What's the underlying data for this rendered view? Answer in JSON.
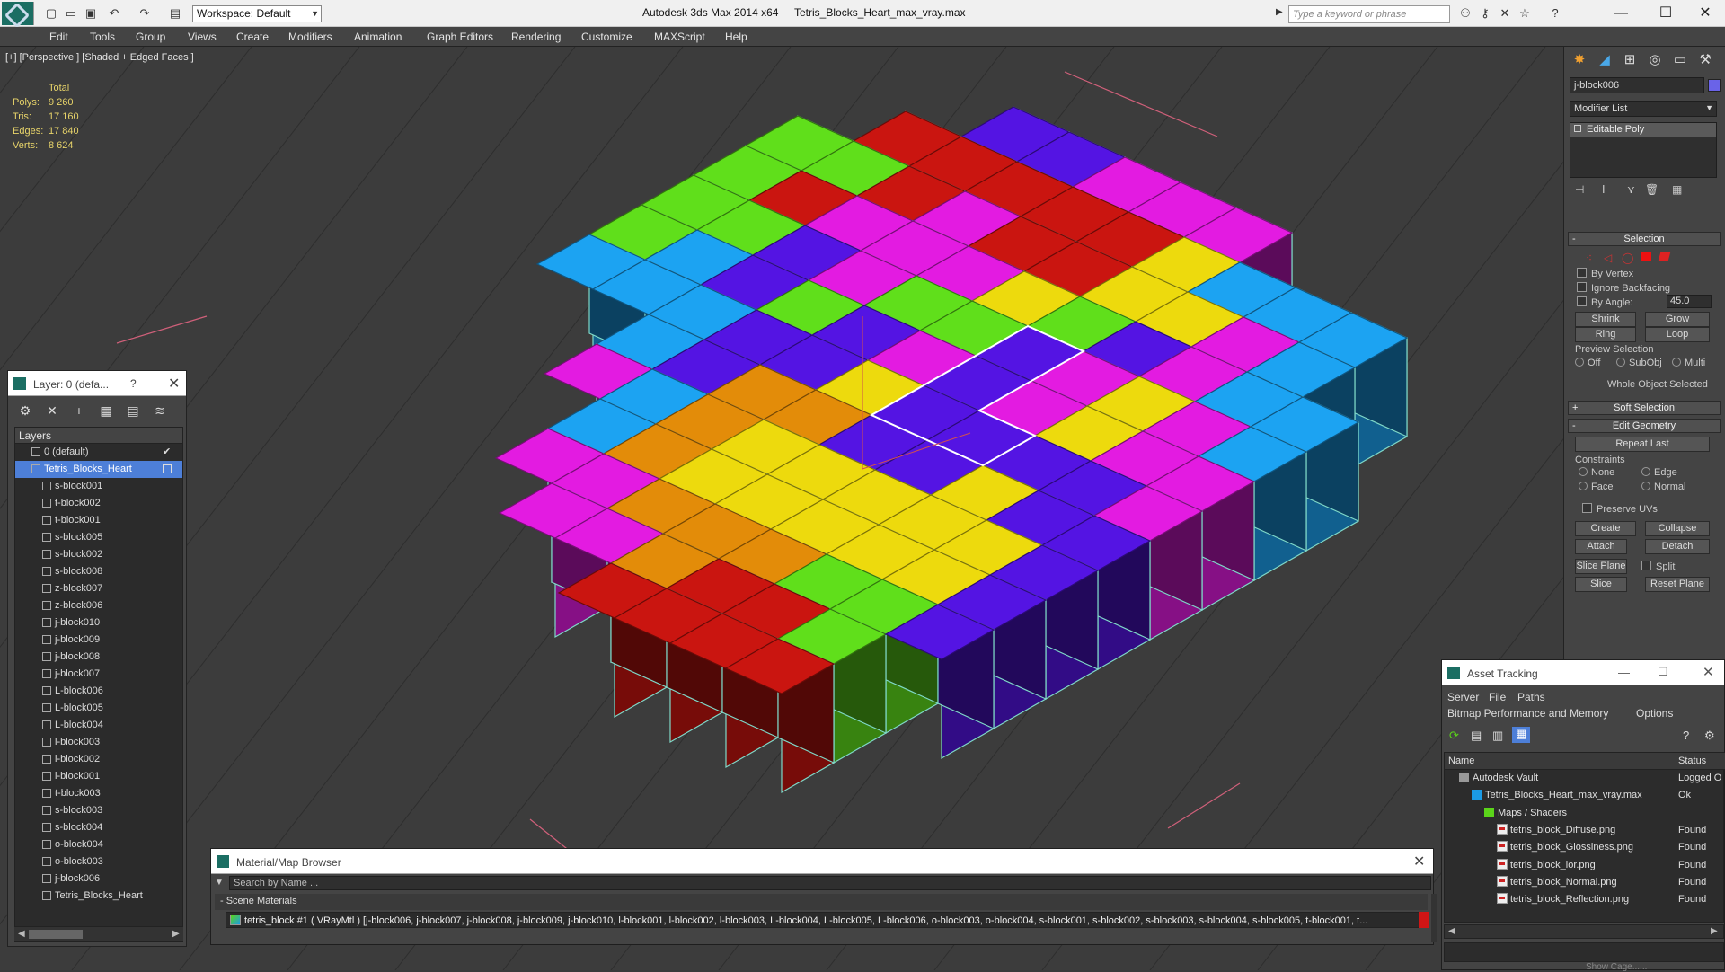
{
  "titlebar": {
    "workspace": "Workspace: Default",
    "app_title": "Autodesk 3ds Max  2014 x64",
    "file_title": "Tetris_Blocks_Heart_max_vray.max",
    "search_placeholder": "Type a keyword or phrase"
  },
  "menu": [
    "Edit",
    "Tools",
    "Group",
    "Views",
    "Create",
    "Modifiers",
    "Animation",
    "Graph Editors",
    "Rendering",
    "Customize",
    "MAXScript",
    "Help"
  ],
  "viewport": {
    "label": "[+] [Perspective ] [Shaded + Edged Faces ]",
    "stats": {
      "total_label": "Total",
      "rows": [
        {
          "label": "Polys:",
          "value": "9 260"
        },
        {
          "label": "Tris:",
          "value": "17 160"
        },
        {
          "label": "Edges:",
          "value": "17 840"
        },
        {
          "label": "Verts:",
          "value": "8 624"
        }
      ]
    }
  },
  "layers": {
    "title": "Layer: 0 (defa...",
    "help": "?",
    "column": "Layers",
    "items": [
      {
        "name": "0 (default)",
        "level": 0
      },
      {
        "name": "Tetris_Blocks_Heart",
        "level": 0,
        "selected": true
      },
      {
        "name": "s-block001",
        "level": 1
      },
      {
        "name": "t-block002",
        "level": 1
      },
      {
        "name": "t-block001",
        "level": 1
      },
      {
        "name": "s-block005",
        "level": 1
      },
      {
        "name": "s-block002",
        "level": 1
      },
      {
        "name": "s-block008",
        "level": 1
      },
      {
        "name": "z-block007",
        "level": 1
      },
      {
        "name": "z-block006",
        "level": 1
      },
      {
        "name": "j-block010",
        "level": 1
      },
      {
        "name": "j-block009",
        "level": 1
      },
      {
        "name": "j-block008",
        "level": 1
      },
      {
        "name": "j-block007",
        "level": 1
      },
      {
        "name": "L-block006",
        "level": 1
      },
      {
        "name": "L-block005",
        "level": 1
      },
      {
        "name": "L-block004",
        "level": 1
      },
      {
        "name": "l-block003",
        "level": 1
      },
      {
        "name": "l-block002",
        "level": 1
      },
      {
        "name": "l-block001",
        "level": 1
      },
      {
        "name": "t-block003",
        "level": 1
      },
      {
        "name": "s-block003",
        "level": 1
      },
      {
        "name": "s-block004",
        "level": 1
      },
      {
        "name": "o-block004",
        "level": 1
      },
      {
        "name": "o-block003",
        "level": 1
      },
      {
        "name": "j-block006",
        "level": 1
      },
      {
        "name": "Tetris_Blocks_Heart",
        "level": 1
      }
    ]
  },
  "command_panel": {
    "object_name": "j-block006",
    "object_color": "#6a63e8",
    "modifier_list": "Modifier List",
    "stack_item": "Editable Poly",
    "selection_title": "Selection",
    "by_vertex": "By Vertex",
    "ignore_backfacing": "Ignore Backfacing",
    "by_angle": "By Angle:",
    "angle_value": "45.0",
    "shrink": "Shrink",
    "grow": "Grow",
    "ring": "Ring",
    "loop": "Loop",
    "preview_selection": "Preview Selection",
    "preview_off": "Off",
    "preview_subobj": "SubObj",
    "preview_multi": "Multi",
    "whole_object": "Whole Object Selected",
    "soft_selection": "Soft Selection",
    "edit_geometry": "Edit Geometry",
    "repeat_last": "Repeat Last",
    "constraints": "Constraints",
    "c_none": "None",
    "c_edge": "Edge",
    "c_face": "Face",
    "c_normal": "Normal",
    "preserve_uvs": "Preserve UVs",
    "create": "Create",
    "collapse": "Collapse",
    "attach": "Attach",
    "detach": "Detach",
    "slice_plane": "Slice Plane",
    "split": "Split",
    "slice": "Slice",
    "reset_plane": "Reset Plane"
  },
  "asset_tracking": {
    "title": "Asset Tracking",
    "menu": [
      "Server",
      "File",
      "Paths"
    ],
    "menu2": [
      "Bitmap Performance and Memory",
      "Options"
    ],
    "col_name": "Name",
    "col_status": "Status",
    "rows": [
      {
        "name": "Autodesk Vault",
        "status": "Logged O",
        "indent": 1
      },
      {
        "name": "Tetris_Blocks_Heart_max_vray.max",
        "status": "Ok",
        "indent": 2
      },
      {
        "name": "Maps / Shaders",
        "status": "",
        "indent": 3
      },
      {
        "name": "tetris_block_Diffuse.png",
        "status": "Found",
        "indent": 4
      },
      {
        "name": "tetris_block_Glossiness.png",
        "status": "Found",
        "indent": 4
      },
      {
        "name": "tetris_block_ior.png",
        "status": "Found",
        "indent": 4
      },
      {
        "name": "tetris_block_Normal.png",
        "status": "Found",
        "indent": 4
      },
      {
        "name": "tetris_block_Reflection.png",
        "status": "Found",
        "indent": 4
      }
    ],
    "footer": "Show Cage......"
  },
  "material_browser": {
    "title": "Material/Map Browser",
    "search_placeholder": "Search by Name ...",
    "section": "- Scene Materials",
    "entry": "tetris_block #1  ( VRayMtl ) [j-block006, j-block007, j-block008, j-block009, j-block010, l-block001, l-block002, l-block003, L-block004, L-block005, L-block006, o-block003, o-block004, s-block001, s-block002, s-block003, s-block004, s-block005, t-block001, t..."
  },
  "colors": {
    "blue": "#1b9be6",
    "green": "#5bd41a",
    "magenta": "#d81ad6",
    "red": "#c0140f",
    "orange": "#d88509",
    "yellow": "#e2d00c",
    "purple": "#5013d8"
  }
}
